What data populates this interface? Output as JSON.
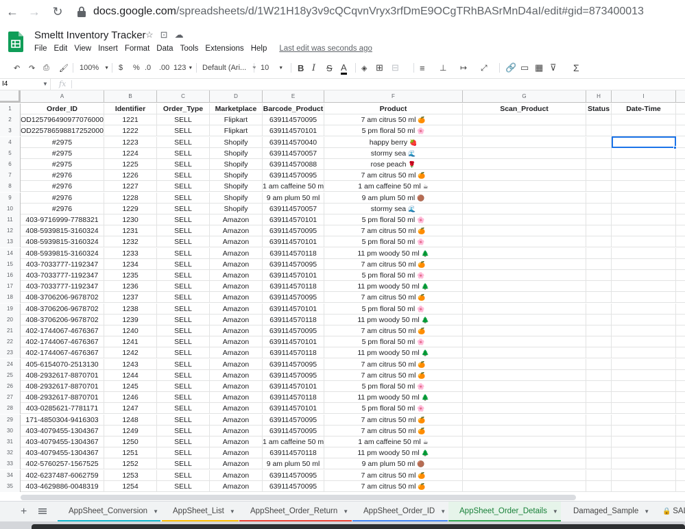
{
  "browser": {
    "url_host": "docs.google.com",
    "url_path": "/spreadsheets/d/1W21H18y3v9cQCqvnVryx3rfDmE9OCgTRhBASrMnD4aI/edit#gid=873400013"
  },
  "app": {
    "title": "Smeltt Inventory Tracker",
    "menu": [
      "File",
      "Edit",
      "View",
      "Insert",
      "Format",
      "Data",
      "Tools",
      "Extensions",
      "Help"
    ],
    "last_edit": "Last edit was seconds ago"
  },
  "toolbar": {
    "zoom": "100%",
    "currency": "$",
    "percent": "%",
    "dec_less": ".0",
    "dec_more": ".00",
    "number_format": "123",
    "font": "Default (Ari...",
    "font_size": "10"
  },
  "formula_bar": {
    "cell_ref": "I4",
    "fx": "fx"
  },
  "grid": {
    "columns": [
      "A",
      "B",
      "C",
      "D",
      "E",
      "F",
      "G",
      "H",
      "I"
    ],
    "headers": [
      "Order_ID",
      "Identifier",
      "Order_Type",
      "Marketplace",
      "Barcode_Product",
      "Product",
      "Scan_Product",
      "Status",
      "Date-Time"
    ],
    "rows": [
      [
        "OD125796490977076000",
        "1221",
        "SELL",
        "Flipkart",
        "639114570095",
        "7 am citrus 50 ml",
        "",
        "",
        ""
      ],
      [
        "OD225786598817252000",
        "1222",
        "SELL",
        "Flipkart",
        "639114570101",
        "5 pm floral 50 ml",
        "",
        "",
        ""
      ],
      [
        "#2975",
        "1223",
        "SELL",
        "Shopify",
        "639114570040",
        "happy berry",
        "",
        "",
        ""
      ],
      [
        "#2975",
        "1224",
        "SELL",
        "Shopify",
        "639114570057",
        "stormy sea",
        "",
        "",
        ""
      ],
      [
        "#2975",
        "1225",
        "SELL",
        "Shopify",
        "639114570088",
        "rose peach",
        "",
        "",
        ""
      ],
      [
        "#2976",
        "1226",
        "SELL",
        "Shopify",
        "639114570095",
        "7 am citrus 50 ml",
        "",
        "",
        ""
      ],
      [
        "#2976",
        "1227",
        "SELL",
        "Shopify",
        "1 am caffeine 50 ml",
        "1 am caffeine 50 ml",
        "",
        "",
        ""
      ],
      [
        "#2976",
        "1228",
        "SELL",
        "Shopify",
        "9 am plum 50 ml",
        "9 am plum 50 ml",
        "",
        "",
        ""
      ],
      [
        "#2976",
        "1229",
        "SELL",
        "Shopify",
        "639114570057",
        "stormy sea",
        "",
        "",
        ""
      ],
      [
        "403-9716999-7788321",
        "1230",
        "SELL",
        "Amazon",
        "639114570101",
        "5 pm floral 50 ml",
        "",
        "",
        ""
      ],
      [
        "408-5939815-3160324",
        "1231",
        "SELL",
        "Amazon",
        "639114570095",
        "7 am citrus 50 ml",
        "",
        "",
        ""
      ],
      [
        "408-5939815-3160324",
        "1232",
        "SELL",
        "Amazon",
        "639114570101",
        "5 pm floral 50 ml",
        "",
        "",
        ""
      ],
      [
        "408-5939815-3160324",
        "1233",
        "SELL",
        "Amazon",
        "639114570118",
        "11 pm woody 50 ml",
        "",
        "",
        ""
      ],
      [
        "403-7033777-1192347",
        "1234",
        "SELL",
        "Amazon",
        "639114570095",
        "7 am citrus 50 ml",
        "",
        "",
        ""
      ],
      [
        "403-7033777-1192347",
        "1235",
        "SELL",
        "Amazon",
        "639114570101",
        "5 pm floral 50 ml",
        "",
        "",
        ""
      ],
      [
        "403-7033777-1192347",
        "1236",
        "SELL",
        "Amazon",
        "639114570118",
        "11 pm woody 50 ml",
        "",
        "",
        ""
      ],
      [
        "408-3706206-9678702",
        "1237",
        "SELL",
        "Amazon",
        "639114570095",
        "7 am citrus 50 ml",
        "",
        "",
        ""
      ],
      [
        "408-3706206-9678702",
        "1238",
        "SELL",
        "Amazon",
        "639114570101",
        "5 pm floral 50 ml",
        "",
        "",
        ""
      ],
      [
        "408-3706206-9678702",
        "1239",
        "SELL",
        "Amazon",
        "639114570118",
        "11 pm woody 50 ml",
        "",
        "",
        ""
      ],
      [
        "402-1744067-4676367",
        "1240",
        "SELL",
        "Amazon",
        "639114570095",
        "7 am citrus 50 ml",
        "",
        "",
        ""
      ],
      [
        "402-1744067-4676367",
        "1241",
        "SELL",
        "Amazon",
        "639114570101",
        "5 pm floral 50 ml",
        "",
        "",
        ""
      ],
      [
        "402-1744067-4676367",
        "1242",
        "SELL",
        "Amazon",
        "639114570118",
        "11 pm woody 50 ml",
        "",
        "",
        ""
      ],
      [
        "405-6154070-2513130",
        "1243",
        "SELL",
        "Amazon",
        "639114570095",
        "7 am citrus 50 ml",
        "",
        "",
        ""
      ],
      [
        "408-2932617-8870701",
        "1244",
        "SELL",
        "Amazon",
        "639114570095",
        "7 am citrus 50 ml",
        "",
        "",
        ""
      ],
      [
        "408-2932617-8870701",
        "1245",
        "SELL",
        "Amazon",
        "639114570101",
        "5 pm floral 50 ml",
        "",
        "",
        ""
      ],
      [
        "408-2932617-8870701",
        "1246",
        "SELL",
        "Amazon",
        "639114570118",
        "11 pm woody 50 ml",
        "",
        "",
        ""
      ],
      [
        "403-0285621-7781171",
        "1247",
        "SELL",
        "Amazon",
        "639114570101",
        "5 pm floral 50 ml",
        "",
        "",
        ""
      ],
      [
        "171-4850304-9416303",
        "1248",
        "SELL",
        "Amazon",
        "639114570095",
        "7 am citrus 50 ml",
        "",
        "",
        ""
      ],
      [
        "403-4079455-1304367",
        "1249",
        "SELL",
        "Amazon",
        "639114570095",
        "7 am citrus 50 ml",
        "",
        "",
        ""
      ],
      [
        "403-4079455-1304367",
        "1250",
        "SELL",
        "Amazon",
        "1 am caffeine 50 ml",
        "1 am caffeine 50 ml",
        "",
        "",
        ""
      ],
      [
        "403-4079455-1304367",
        "1251",
        "SELL",
        "Amazon",
        "639114570118",
        "11 pm woody 50 ml",
        "",
        "",
        ""
      ],
      [
        "402-5760257-1567525",
        "1252",
        "SELL",
        "Amazon",
        "9 am plum 50 ml",
        "9 am plum 50 ml",
        "",
        "",
        ""
      ],
      [
        "402-6237487-6062759",
        "1253",
        "SELL",
        "Amazon",
        "639114570095",
        "7 am citrus 50 ml",
        "",
        "",
        ""
      ],
      [
        "403-4629886-0048319",
        "1254",
        "SELL",
        "Amazon",
        "639114570095",
        "7 am citrus 50 ml",
        "",
        "",
        ""
      ]
    ],
    "product_icons": {
      "7 am citrus 50 ml": "🍊",
      "5 pm floral 50 ml": "🌸",
      "happy berry": "🍓",
      "stormy sea": "🌊",
      "rose peach": "🌹",
      "1 am caffeine 50 ml": "☕",
      "9 am plum 50 ml": "🟤",
      "11 pm woody 50 ml": "🌲"
    },
    "selected_cell": "I4"
  },
  "tabs": [
    {
      "label": "AppSheet_Conversion",
      "color": "#12b5cb",
      "active": false
    },
    {
      "label": "AppSheet_List",
      "color": "#fbbc04",
      "active": false
    },
    {
      "label": "AppSheet_Order_Return",
      "color": "#ea4335",
      "active": false
    },
    {
      "label": "AppSheet_Order_ID",
      "color": "#4285f4",
      "active": false
    },
    {
      "label": "AppSheet_Order_Details",
      "color": "#34a853",
      "active": true
    },
    {
      "label": "Damaged_Sample",
      "color": "",
      "active": false
    },
    {
      "label": "SAL",
      "color": "",
      "active": false
    }
  ]
}
